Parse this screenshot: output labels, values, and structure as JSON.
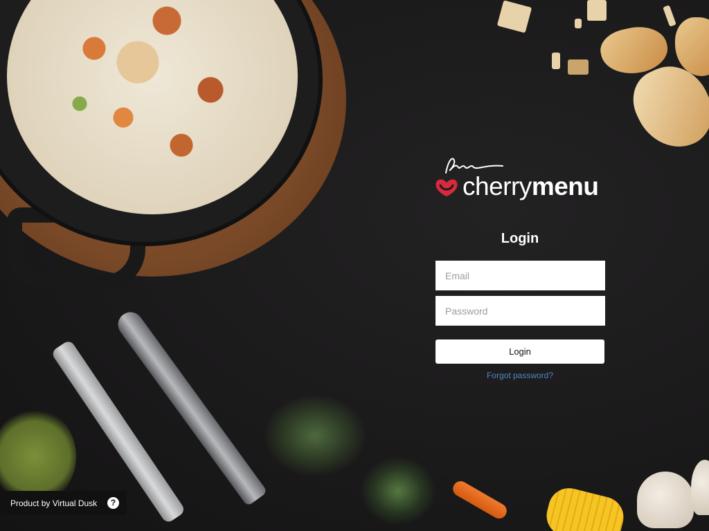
{
  "brand": {
    "name_light": "cherry",
    "name_bold": "menu",
    "accent_color": "#d72a3c",
    "logo_icon": "cherry-heart-icon"
  },
  "login": {
    "title": "Login",
    "email_placeholder": "Email",
    "password_placeholder": "Password",
    "submit_label": "Login",
    "forgot_label": "Forgot password?",
    "link_color": "#4d86c6"
  },
  "footer": {
    "product_label": "Product by Virtual Dusk",
    "help_icon": "help-icon",
    "help_glyph": "?"
  },
  "background": {
    "color": "#1c1b1c",
    "decor": [
      "pan-of-food",
      "bread",
      "fork",
      "knife",
      "herbs",
      "carrot",
      "corn",
      "mushroom"
    ]
  }
}
